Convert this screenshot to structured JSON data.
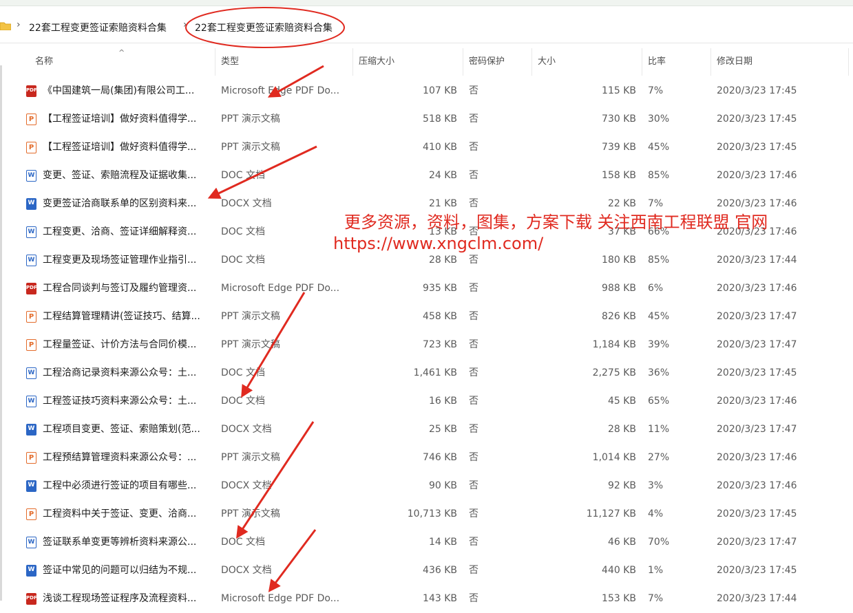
{
  "breadcrumb": {
    "items": [
      "22套工程变更签证索赔资料合集",
      "22套工程变更签证索赔资料合集"
    ]
  },
  "columns": {
    "name": "名称",
    "type": "类型",
    "compressed": "压缩大小",
    "password": "密码保护",
    "size": "大小",
    "ratio": "比率",
    "modified": "修改日期"
  },
  "files": [
    {
      "icon": "pdf-icon",
      "name": "《中国建筑一局(集团)有限公司工...",
      "type": "Microsoft Edge PDF Do...",
      "compressed": "107 KB",
      "password": "否",
      "size": "115 KB",
      "ratio": "7%",
      "modified": "2020/3/23 17:45"
    },
    {
      "icon": "ppt-icon",
      "name": "【工程签证培训】做好资料值得学...",
      "type": "PPT 演示文稿",
      "compressed": "518 KB",
      "password": "否",
      "size": "730 KB",
      "ratio": "30%",
      "modified": "2020/3/23 17:45"
    },
    {
      "icon": "ppt-icon",
      "name": "【工程签证培训】做好资料值得学...",
      "type": "PPT 演示文稿",
      "compressed": "410 KB",
      "password": "否",
      "size": "739 KB",
      "ratio": "45%",
      "modified": "2020/3/23 17:45"
    },
    {
      "icon": "doc-icon",
      "name": "变更、签证、索赔流程及证据收集...",
      "type": "DOC 文档",
      "compressed": "24 KB",
      "password": "否",
      "size": "158 KB",
      "ratio": "85%",
      "modified": "2020/3/23 17:46"
    },
    {
      "icon": "docx-icon",
      "name": "变更签证洽商联系单的区别资料来...",
      "type": "DOCX 文档",
      "compressed": "21 KB",
      "password": "否",
      "size": "22 KB",
      "ratio": "7%",
      "modified": "2020/3/23 17:46"
    },
    {
      "icon": "doc-icon",
      "name": "工程变更、洽商、签证详细解释资...",
      "type": "DOC 文档",
      "compressed": "13 KB",
      "password": "否",
      "size": "37 KB",
      "ratio": "66%",
      "modified": "2020/3/23 17:46"
    },
    {
      "icon": "doc-icon",
      "name": "工程变更及现场签证管理作业指引...",
      "type": "DOC 文档",
      "compressed": "28 KB",
      "password": "否",
      "size": "180 KB",
      "ratio": "85%",
      "modified": "2020/3/23 17:44"
    },
    {
      "icon": "pdf-icon",
      "name": "工程合同谈判与签订及履约管理资...",
      "type": "Microsoft Edge PDF Do...",
      "compressed": "935 KB",
      "password": "否",
      "size": "988 KB",
      "ratio": "6%",
      "modified": "2020/3/23 17:46"
    },
    {
      "icon": "ppt-icon",
      "name": "工程结算管理精讲(签证技巧、结算...",
      "type": "PPT 演示文稿",
      "compressed": "458 KB",
      "password": "否",
      "size": "826 KB",
      "ratio": "45%",
      "modified": "2020/3/23 17:47"
    },
    {
      "icon": "ppt-icon",
      "name": "工程量签证、计价方法与合同价模...",
      "type": "PPT 演示文稿",
      "compressed": "723 KB",
      "password": "否",
      "size": "1,184 KB",
      "ratio": "39%",
      "modified": "2020/3/23 17:47"
    },
    {
      "icon": "doc-icon",
      "name": "工程洽商记录资料来源公众号：土...",
      "type": "DOC 文档",
      "compressed": "1,461 KB",
      "password": "否",
      "size": "2,275 KB",
      "ratio": "36%",
      "modified": "2020/3/23 17:45"
    },
    {
      "icon": "doc-icon",
      "name": "工程签证技巧资料来源公众号：土...",
      "type": "DOC 文档",
      "compressed": "16 KB",
      "password": "否",
      "size": "45 KB",
      "ratio": "65%",
      "modified": "2020/3/23 17:46"
    },
    {
      "icon": "docx-icon",
      "name": "工程项目变更、签证、索赔策划(范...",
      "type": "DOCX 文档",
      "compressed": "25 KB",
      "password": "否",
      "size": "28 KB",
      "ratio": "11%",
      "modified": "2020/3/23 17:47"
    },
    {
      "icon": "ppt-icon",
      "name": "工程预结算管理资料来源公众号：...",
      "type": "PPT 演示文稿",
      "compressed": "746 KB",
      "password": "否",
      "size": "1,014 KB",
      "ratio": "27%",
      "modified": "2020/3/23 17:46"
    },
    {
      "icon": "docx-icon",
      "name": "工程中必须进行签证的项目有哪些...",
      "type": "DOCX 文档",
      "compressed": "90 KB",
      "password": "否",
      "size": "92 KB",
      "ratio": "3%",
      "modified": "2020/3/23 17:46"
    },
    {
      "icon": "ppt-icon",
      "name": "工程资料中关于签证、变更、洽商...",
      "type": "PPT 演示文稿",
      "compressed": "10,713 KB",
      "password": "否",
      "size": "11,127 KB",
      "ratio": "4%",
      "modified": "2020/3/23 17:45"
    },
    {
      "icon": "doc-icon",
      "name": "签证联系单变更等辨析资料来源公...",
      "type": "DOC 文档",
      "compressed": "14 KB",
      "password": "否",
      "size": "46 KB",
      "ratio": "70%",
      "modified": "2020/3/23 17:47"
    },
    {
      "icon": "docx-icon",
      "name": "签证中常见的问题可以归结为不规...",
      "type": "DOCX 文档",
      "compressed": "436 KB",
      "password": "否",
      "size": "440 KB",
      "ratio": "1%",
      "modified": "2020/3/23 17:45"
    },
    {
      "icon": "pdf-icon",
      "name": "浅谈工程现场签证程序及流程资料...",
      "type": "Microsoft Edge PDF Do...",
      "compressed": "143 KB",
      "password": "否",
      "size": "153 KB",
      "ratio": "7%",
      "modified": "2020/3/23 17:44"
    }
  ],
  "watermark": {
    "line1": "更多资源，资料，图集，方案下载  关注西南工程联盟  官网",
    "line2": "https://www.xngclm.com/",
    "color": "#e02a20"
  },
  "colors": {
    "annotation": "#e02a20",
    "pdf": "#c8281e",
    "ppt": "#e36b2a",
    "doc": "#2b66c5"
  }
}
